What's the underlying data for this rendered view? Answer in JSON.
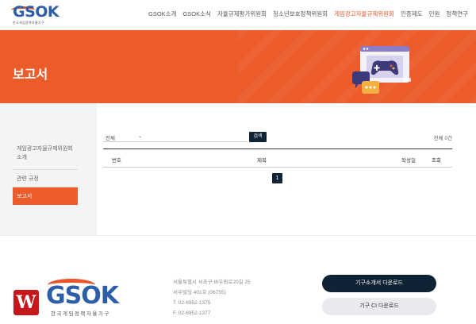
{
  "header": {
    "logo_text": "GSOK",
    "logo_sub": "한국게임정책자율기구",
    "nav": [
      {
        "label": "GSOK소개"
      },
      {
        "label": "GSOK소식"
      },
      {
        "label": "자율규제평가위원회"
      },
      {
        "label": "청소년보호정책위원회"
      },
      {
        "label": "게임광고자율규제위원회",
        "active": true
      },
      {
        "label": "인증제도"
      },
      {
        "label": "민원"
      },
      {
        "label": "정책연구"
      }
    ]
  },
  "hero": {
    "title": "보고서",
    "accent_color": "#ec5b2a"
  },
  "sidebar": {
    "items": [
      {
        "label": "게임광고자율규제위원회 소개"
      },
      {
        "label": "관련 규정"
      },
      {
        "label": "보고서",
        "active": true
      }
    ]
  },
  "search": {
    "select_value": "전체",
    "input_value": "",
    "button_label": "검색",
    "total_label": "전체 0건"
  },
  "table": {
    "columns": [
      "번호",
      "제목",
      "작성일",
      "조회"
    ]
  },
  "pagination": {
    "pages": [
      "1"
    ]
  },
  "footer": {
    "logo_text": "GSOK",
    "logo_sub": "한국게임정책자율기구",
    "w_logo": "W",
    "address_lines": [
      "서울특별시 서초구 바우뫼로20길 25",
      "서우빌딩 401호 (06755)",
      "T. 02-6952-1375",
      "F. 02-6952-1377"
    ],
    "download_label": "기구소개서 다운로드",
    "ci_label": "기구 CI 다운로드"
  }
}
